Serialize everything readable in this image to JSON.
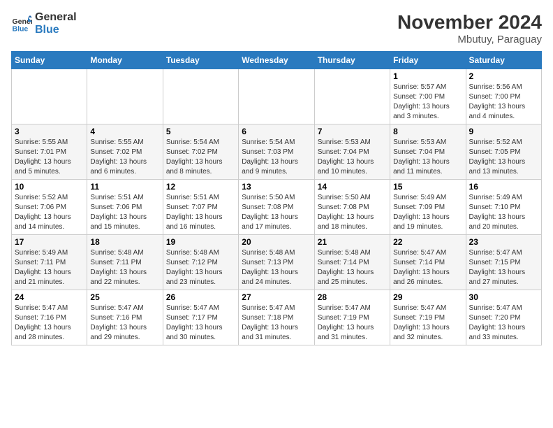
{
  "header": {
    "logo_line1": "General",
    "logo_line2": "Blue",
    "month_title": "November 2024",
    "location": "Mbutuy, Paraguay"
  },
  "weekdays": [
    "Sunday",
    "Monday",
    "Tuesday",
    "Wednesday",
    "Thursday",
    "Friday",
    "Saturday"
  ],
  "weeks": [
    [
      {
        "day": "",
        "info": ""
      },
      {
        "day": "",
        "info": ""
      },
      {
        "day": "",
        "info": ""
      },
      {
        "day": "",
        "info": ""
      },
      {
        "day": "",
        "info": ""
      },
      {
        "day": "1",
        "info": "Sunrise: 5:57 AM\nSunset: 7:00 PM\nDaylight: 13 hours\nand 3 minutes."
      },
      {
        "day": "2",
        "info": "Sunrise: 5:56 AM\nSunset: 7:00 PM\nDaylight: 13 hours\nand 4 minutes."
      }
    ],
    [
      {
        "day": "3",
        "info": "Sunrise: 5:55 AM\nSunset: 7:01 PM\nDaylight: 13 hours\nand 5 minutes."
      },
      {
        "day": "4",
        "info": "Sunrise: 5:55 AM\nSunset: 7:02 PM\nDaylight: 13 hours\nand 6 minutes."
      },
      {
        "day": "5",
        "info": "Sunrise: 5:54 AM\nSunset: 7:02 PM\nDaylight: 13 hours\nand 8 minutes."
      },
      {
        "day": "6",
        "info": "Sunrise: 5:54 AM\nSunset: 7:03 PM\nDaylight: 13 hours\nand 9 minutes."
      },
      {
        "day": "7",
        "info": "Sunrise: 5:53 AM\nSunset: 7:04 PM\nDaylight: 13 hours\nand 10 minutes."
      },
      {
        "day": "8",
        "info": "Sunrise: 5:53 AM\nSunset: 7:04 PM\nDaylight: 13 hours\nand 11 minutes."
      },
      {
        "day": "9",
        "info": "Sunrise: 5:52 AM\nSunset: 7:05 PM\nDaylight: 13 hours\nand 13 minutes."
      }
    ],
    [
      {
        "day": "10",
        "info": "Sunrise: 5:52 AM\nSunset: 7:06 PM\nDaylight: 13 hours\nand 14 minutes."
      },
      {
        "day": "11",
        "info": "Sunrise: 5:51 AM\nSunset: 7:06 PM\nDaylight: 13 hours\nand 15 minutes."
      },
      {
        "day": "12",
        "info": "Sunrise: 5:51 AM\nSunset: 7:07 PM\nDaylight: 13 hours\nand 16 minutes."
      },
      {
        "day": "13",
        "info": "Sunrise: 5:50 AM\nSunset: 7:08 PM\nDaylight: 13 hours\nand 17 minutes."
      },
      {
        "day": "14",
        "info": "Sunrise: 5:50 AM\nSunset: 7:08 PM\nDaylight: 13 hours\nand 18 minutes."
      },
      {
        "day": "15",
        "info": "Sunrise: 5:49 AM\nSunset: 7:09 PM\nDaylight: 13 hours\nand 19 minutes."
      },
      {
        "day": "16",
        "info": "Sunrise: 5:49 AM\nSunset: 7:10 PM\nDaylight: 13 hours\nand 20 minutes."
      }
    ],
    [
      {
        "day": "17",
        "info": "Sunrise: 5:49 AM\nSunset: 7:11 PM\nDaylight: 13 hours\nand 21 minutes."
      },
      {
        "day": "18",
        "info": "Sunrise: 5:48 AM\nSunset: 7:11 PM\nDaylight: 13 hours\nand 22 minutes."
      },
      {
        "day": "19",
        "info": "Sunrise: 5:48 AM\nSunset: 7:12 PM\nDaylight: 13 hours\nand 23 minutes."
      },
      {
        "day": "20",
        "info": "Sunrise: 5:48 AM\nSunset: 7:13 PM\nDaylight: 13 hours\nand 24 minutes."
      },
      {
        "day": "21",
        "info": "Sunrise: 5:48 AM\nSunset: 7:14 PM\nDaylight: 13 hours\nand 25 minutes."
      },
      {
        "day": "22",
        "info": "Sunrise: 5:47 AM\nSunset: 7:14 PM\nDaylight: 13 hours\nand 26 minutes."
      },
      {
        "day": "23",
        "info": "Sunrise: 5:47 AM\nSunset: 7:15 PM\nDaylight: 13 hours\nand 27 minutes."
      }
    ],
    [
      {
        "day": "24",
        "info": "Sunrise: 5:47 AM\nSunset: 7:16 PM\nDaylight: 13 hours\nand 28 minutes."
      },
      {
        "day": "25",
        "info": "Sunrise: 5:47 AM\nSunset: 7:16 PM\nDaylight: 13 hours\nand 29 minutes."
      },
      {
        "day": "26",
        "info": "Sunrise: 5:47 AM\nSunset: 7:17 PM\nDaylight: 13 hours\nand 30 minutes."
      },
      {
        "day": "27",
        "info": "Sunrise: 5:47 AM\nSunset: 7:18 PM\nDaylight: 13 hours\nand 31 minutes."
      },
      {
        "day": "28",
        "info": "Sunrise: 5:47 AM\nSunset: 7:19 PM\nDaylight: 13 hours\nand 31 minutes."
      },
      {
        "day": "29",
        "info": "Sunrise: 5:47 AM\nSunset: 7:19 PM\nDaylight: 13 hours\nand 32 minutes."
      },
      {
        "day": "30",
        "info": "Sunrise: 5:47 AM\nSunset: 7:20 PM\nDaylight: 13 hours\nand 33 minutes."
      }
    ]
  ]
}
